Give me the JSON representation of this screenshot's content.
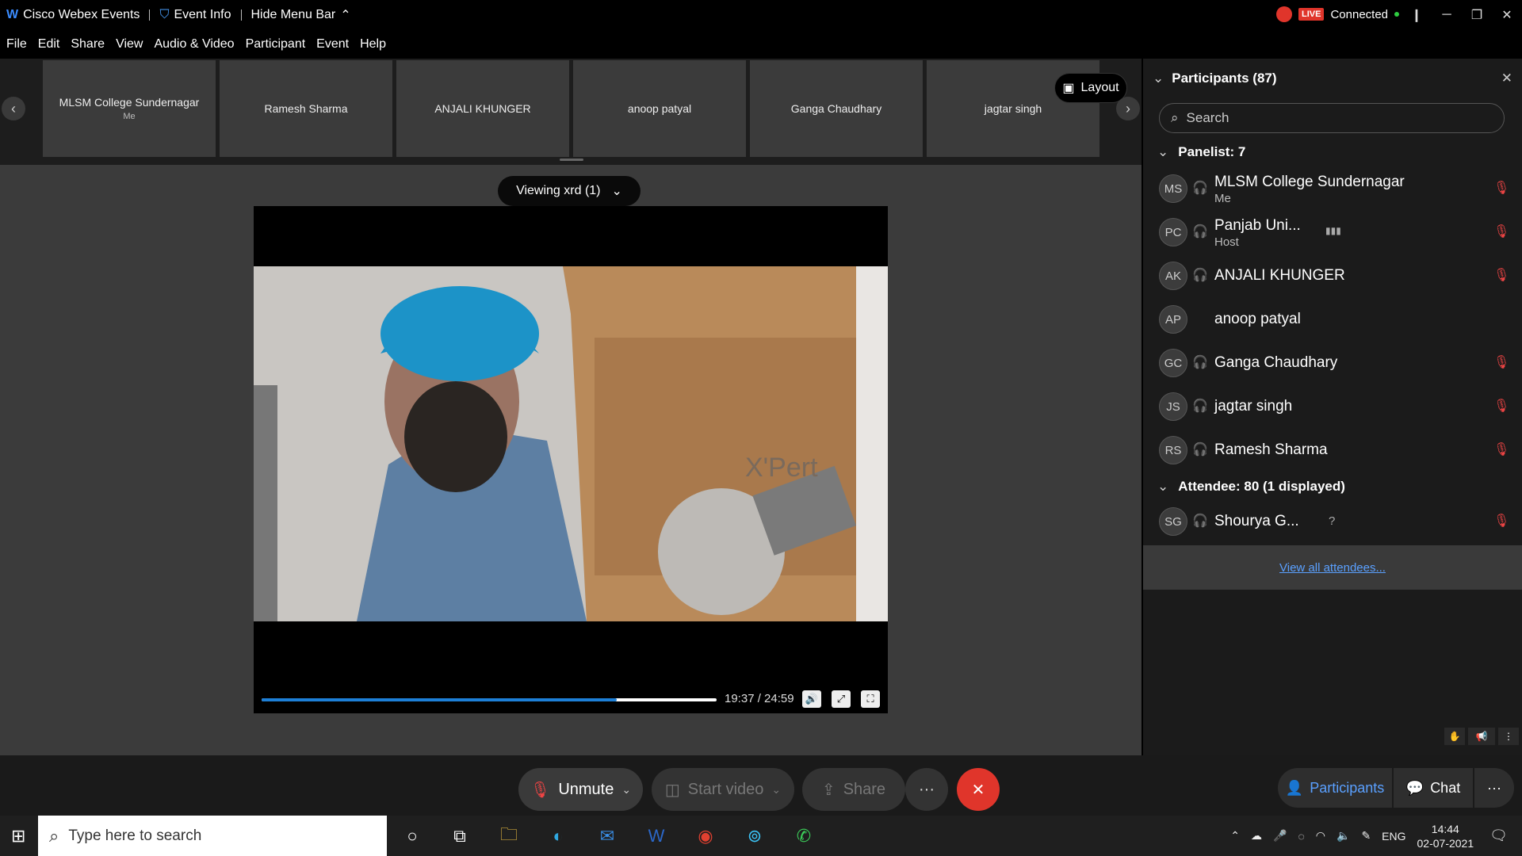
{
  "titlebar": {
    "app_name": "Cisco Webex Events",
    "event_info": "Event Info",
    "hide_menu": "Hide Menu Bar",
    "live_badge": "LIVE",
    "connection_status": "Connected"
  },
  "menu": {
    "file": "File",
    "edit": "Edit",
    "share": "Share",
    "view": "View",
    "audio_video": "Audio & Video",
    "participant": "Participant",
    "event": "Event",
    "help": "Help"
  },
  "filmstrip": {
    "tiles": [
      {
        "name": "MLSM College Sundernagar",
        "sub": "Me"
      },
      {
        "name": "Ramesh Sharma",
        "sub": ""
      },
      {
        "name": "ANJALI KHUNGER",
        "sub": ""
      },
      {
        "name": "anoop patyal",
        "sub": ""
      },
      {
        "name": "Ganga Chaudhary",
        "sub": ""
      },
      {
        "name": "jagtar singh",
        "sub": ""
      }
    ],
    "layout_label": "Layout"
  },
  "stage": {
    "viewing_label": "Viewing xrd (1)",
    "video_text": "X'Pert",
    "timecode": "19:37 / 24:59",
    "progress": 0.78
  },
  "controls": {
    "unmute": "Unmute",
    "start_video": "Start video",
    "share": "Share",
    "participants": "Participants",
    "chat": "Chat"
  },
  "participants": {
    "title": "Participants (87)",
    "search_placeholder": "Search",
    "panelist_header": "Panelist: 7",
    "attendee_header": "Attendee: 80 (1 displayed)",
    "view_all": "View all attendees...",
    "panelists": [
      {
        "initials": "MS",
        "name": "MLSM College Sundernagar",
        "role": "Me"
      },
      {
        "initials": "PC",
        "name": "Panjab Uni...",
        "role": "Host"
      },
      {
        "initials": "AK",
        "name": "ANJALI KHUNGER",
        "role": ""
      },
      {
        "initials": "AP",
        "name": "anoop patyal",
        "role": ""
      },
      {
        "initials": "GC",
        "name": "Ganga Chaudhary",
        "role": ""
      },
      {
        "initials": "JS",
        "name": "jagtar singh",
        "role": ""
      },
      {
        "initials": "RS",
        "name": "Ramesh Sharma",
        "role": ""
      }
    ],
    "attendees": [
      {
        "initials": "SG",
        "name": "Shourya G...",
        "extra": "?"
      }
    ]
  },
  "taskbar": {
    "search_placeholder": "Type here to search",
    "lang": "ENG",
    "time": "14:44",
    "date": "02-07-2021"
  },
  "colors": {
    "accent": "#1d7fd6",
    "leave": "#e0352b",
    "live": "#e0352b"
  }
}
